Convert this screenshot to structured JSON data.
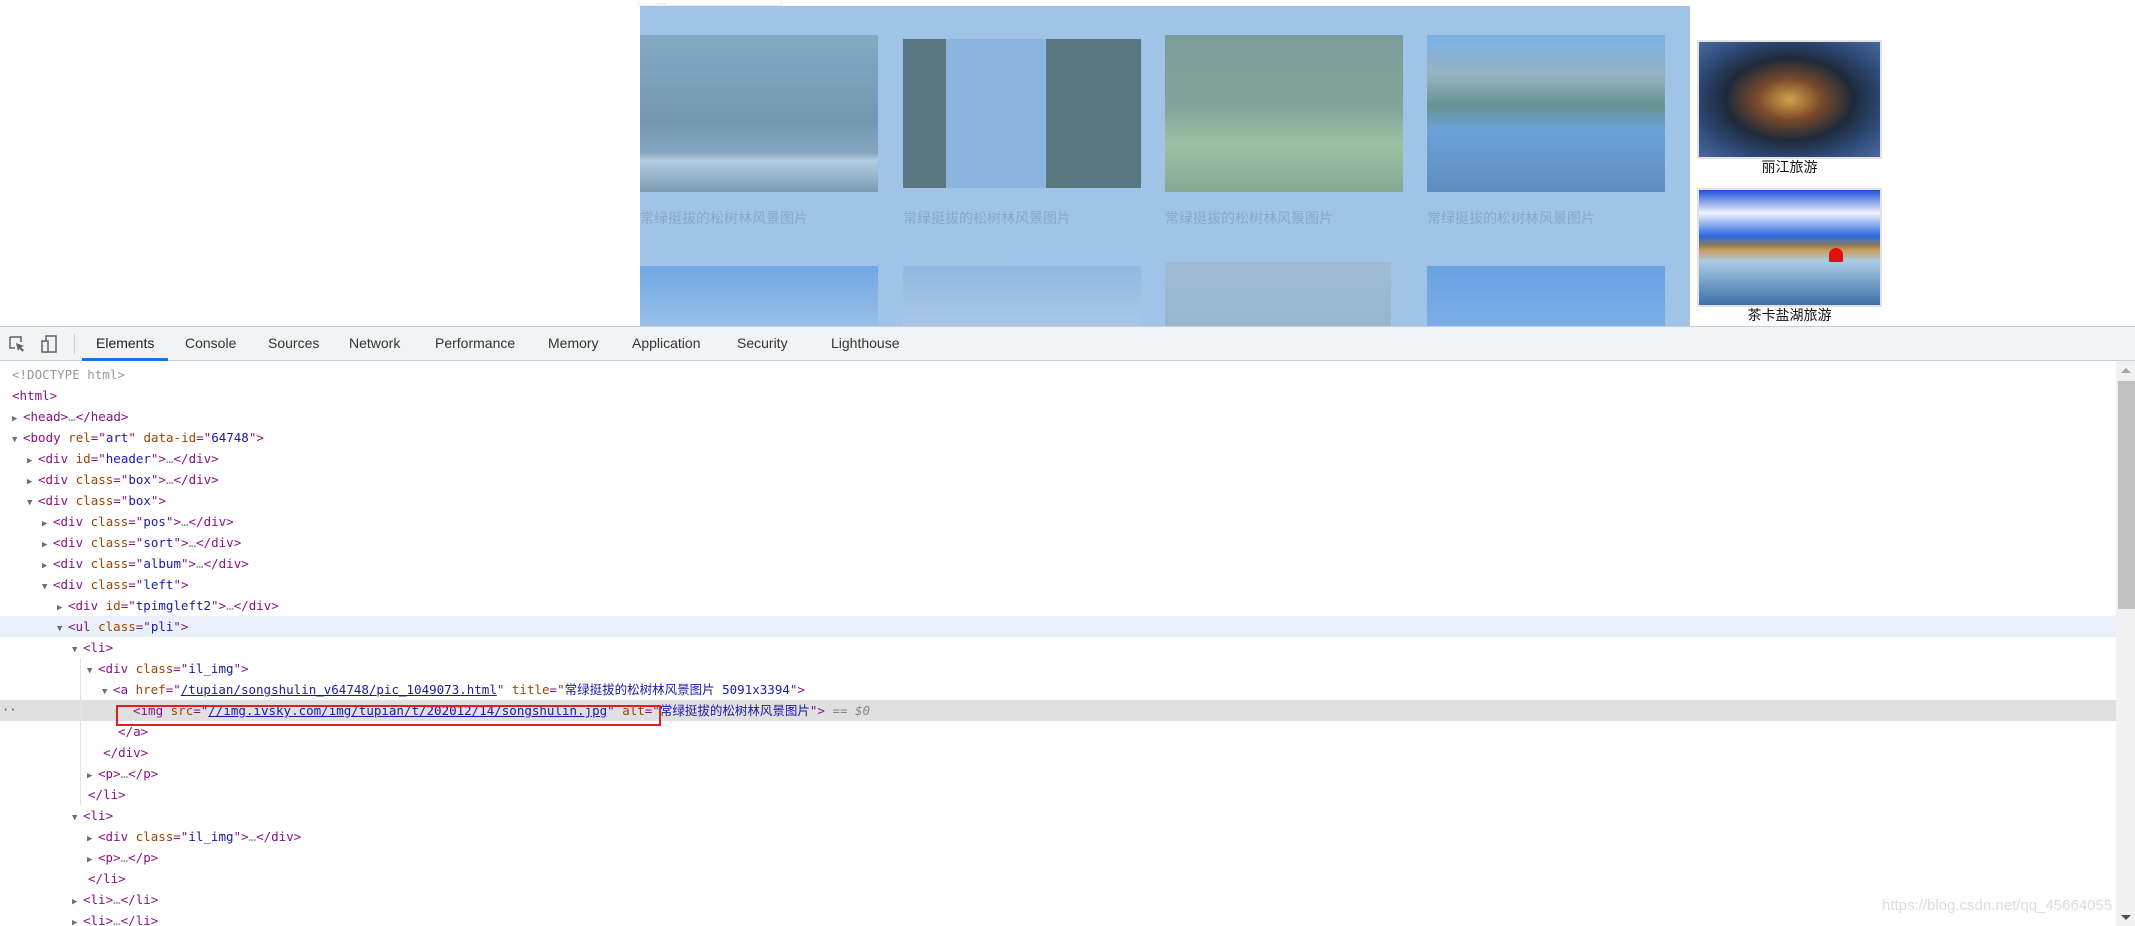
{
  "page": {
    "gallery": {
      "items": [
        {
          "caption": "常绿挺拔的松树林风景图片"
        },
        {
          "caption": "常绿挺拔的松树林风景图片"
        },
        {
          "caption": "常绿挺拔的松树林风景图片"
        },
        {
          "caption": "常绿挺拔的松树林风景图片"
        }
      ]
    },
    "sidebar": {
      "items": [
        {
          "label": "丽江旅游"
        },
        {
          "label": "茶卡盐湖旅游"
        }
      ]
    }
  },
  "devtools": {
    "toolbar": {
      "inspect_icon": "select-element-icon",
      "device_icon": "device-toolbar-icon"
    },
    "tabs": [
      {
        "label": "Elements",
        "active": true
      },
      {
        "label": "Console"
      },
      {
        "label": "Sources"
      },
      {
        "label": "Network"
      },
      {
        "label": "Performance"
      },
      {
        "label": "Memory"
      },
      {
        "label": "Application"
      },
      {
        "label": "Security"
      },
      {
        "label": "Lighthouse"
      }
    ],
    "dom": {
      "doctype": "<!DOCTYPE html>",
      "html_open": "<html>",
      "head": {
        "tag": "head"
      },
      "body": {
        "tag": "body",
        "attr1": "rel",
        "val1": "art",
        "attr2": "data-id",
        "val2": "64748"
      },
      "header": {
        "tag": "div",
        "attr": "id",
        "val": "header"
      },
      "box1": {
        "tag": "div",
        "attr": "class",
        "val": "box"
      },
      "box2": {
        "tag": "div",
        "attr": "class",
        "val": "box"
      },
      "pos": {
        "tag": "div",
        "attr": "class",
        "val": "pos"
      },
      "sort": {
        "tag": "div",
        "attr": "class",
        "val": "sort"
      },
      "album": {
        "tag": "div",
        "attr": "class",
        "val": "album"
      },
      "left": {
        "tag": "div",
        "attr": "class",
        "val": "left"
      },
      "tpimgleft2": {
        "tag": "div",
        "attr": "id",
        "val": "tpimgleft2"
      },
      "ul": {
        "tag": "ul",
        "attr": "class",
        "val": "pli"
      },
      "li": {
        "tag": "li"
      },
      "il_img": {
        "tag": "div",
        "attr": "class",
        "val": "il_img"
      },
      "a": {
        "tag": "a",
        "href_attr": "href",
        "href": "/tupian/songshulin_v64748/pic_1049073.html",
        "title_attr": "title",
        "title": "常绿挺拔的松树林风景图片 5091x3394"
      },
      "img": {
        "tag": "img",
        "src_attr": "src",
        "src": "//img.ivsky.com/img/tupian/t/202012/14/songshulin.jpg",
        "alt_attr": "alt",
        "alt": "常绿挺拔的松树林风景图片",
        "console_ref": "== $0"
      },
      "p": {
        "tag": "p"
      },
      "ellipsis": "…"
    }
  },
  "watermark": "https://blog.csdn.net/qq_45664055"
}
